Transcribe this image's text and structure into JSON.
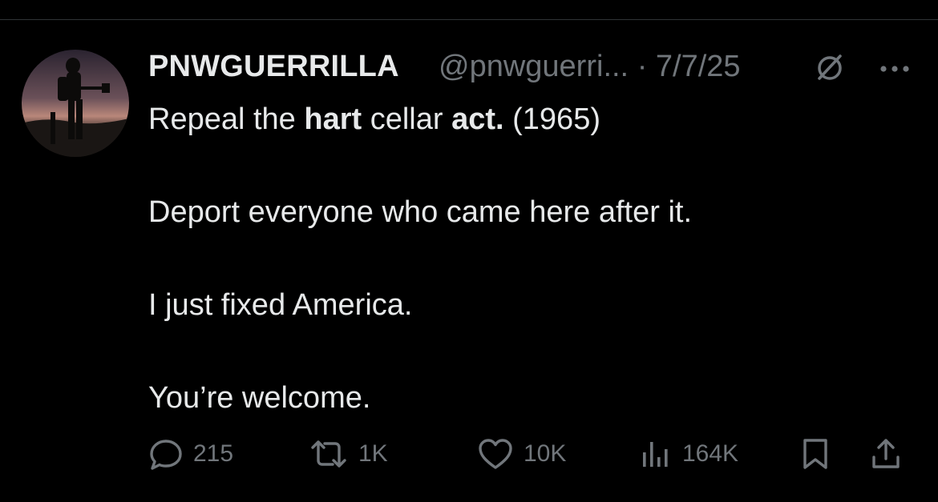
{
  "tweet": {
    "display_name": "PNWGUERRILLA",
    "handle": "@pnwguerri...",
    "separator": "·",
    "date": "7/7/25",
    "lines": {
      "l1_a": "Repeal the ",
      "l1_b": "hart",
      "l1_c": " cellar ",
      "l1_d": "act.",
      "l1_e": " (1965)",
      "l2": "Deport everyone who came here after it.",
      "l3": "I just fixed America.",
      "l4": "You’re welcome."
    }
  },
  "actions": {
    "replies": "215",
    "reposts": "1K",
    "likes": "10K",
    "views": "164K"
  },
  "icons": {
    "avatar": "silhouette-soldier-sunset",
    "grok": "grok-slash-circle-icon",
    "more": "more-dots-icon",
    "reply": "speech-bubble-icon",
    "repost": "repost-arrows-icon",
    "like": "heart-icon",
    "views": "bar-chart-icon",
    "bookmark": "bookmark-icon",
    "share": "share-upload-icon"
  },
  "colors": {
    "background": "#000000",
    "primary_text": "#e7e9ea",
    "secondary_text": "#71767b",
    "divider": "#2f3336"
  }
}
